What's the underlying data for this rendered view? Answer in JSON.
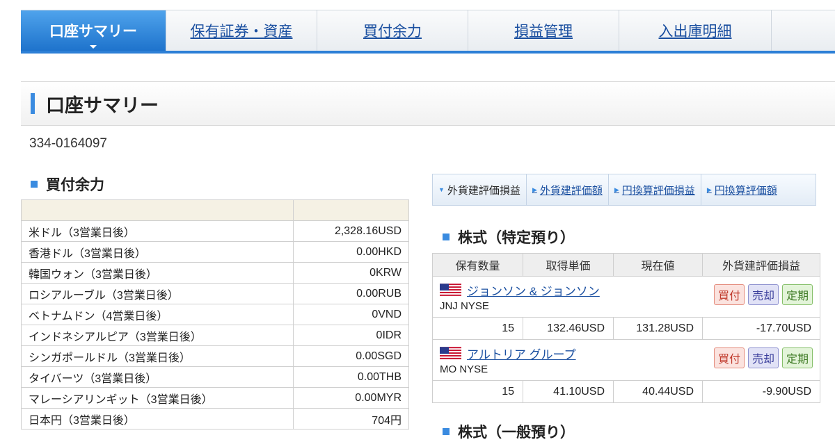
{
  "nav": {
    "tabs": [
      {
        "label": "口座サマリー"
      },
      {
        "label": "保有証券・資産"
      },
      {
        "label": "買付余力"
      },
      {
        "label": "損益管理"
      },
      {
        "label": "入出庫明細"
      }
    ],
    "active_index": 0
  },
  "page": {
    "title": "口座サマリー",
    "account_number": "334-0164097"
  },
  "buying_power": {
    "title": "買付余力",
    "rows": [
      {
        "label": "米ドル（3営業日後）",
        "value": "2,328.16USD"
      },
      {
        "label": "香港ドル（3営業日後）",
        "value": "0.00HKD"
      },
      {
        "label": "韓国ウォン（3営業日後）",
        "value": "0KRW"
      },
      {
        "label": "ロシアルーブル（3営業日後）",
        "value": "0.00RUB"
      },
      {
        "label": "ベトナムドン（4営業日後）",
        "value": "0VND"
      },
      {
        "label": "インドネシアルピア（3営業日後）",
        "value": "0IDR"
      },
      {
        "label": "シンガポールドル（3営業日後）",
        "value": "0.00SGD"
      },
      {
        "label": "タイバーツ（3営業日後）",
        "value": "0.00THB"
      },
      {
        "label": "マレーシアリンギット（3営業日後）",
        "value": "0.00MYR"
      },
      {
        "label": "日本円（3営業日後）",
        "value": "704円"
      }
    ]
  },
  "view_tabs": [
    {
      "label": "外貨建評価損益",
      "active": true
    },
    {
      "label": "外貨建評価額",
      "active": false
    },
    {
      "label": "円換算評価損益",
      "active": false
    },
    {
      "label": "円換算評価額",
      "active": false
    }
  ],
  "stocks_specific": {
    "title": "株式（特定預り）",
    "headers": [
      "保有数量",
      "取得単価",
      "現在値",
      "外貨建評価損益"
    ],
    "buttons": {
      "buy": "買付",
      "sell": "売却",
      "regular": "定期"
    },
    "items": [
      {
        "name": "ジョンソン & ジョンソン",
        "code": "JNJ NYSE",
        "quantity": "15",
        "cost": "132.46USD",
        "price": "131.28USD",
        "pl": "-17.70USD"
      },
      {
        "name": "アルトリア グループ",
        "code": "MO NYSE",
        "quantity": "15",
        "cost": "41.10USD",
        "price": "40.44USD",
        "pl": "-9.90USD"
      }
    ]
  },
  "stocks_general": {
    "title": "株式（一般預り）"
  },
  "colors": {
    "accent": "#2c7fd6",
    "link": "#1a4fa0"
  },
  "icons": [
    "us-flag-icon"
  ]
}
